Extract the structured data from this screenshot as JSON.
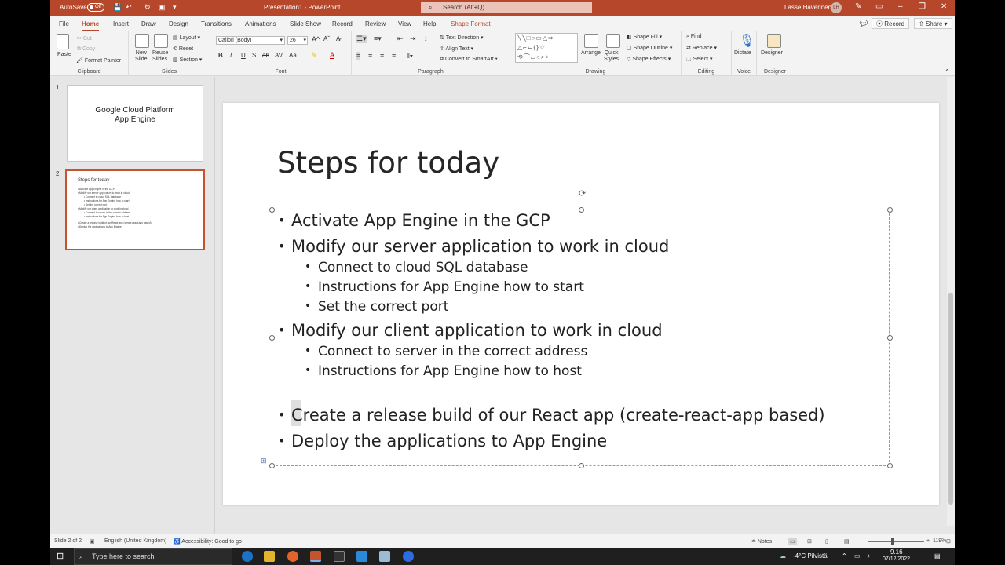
{
  "titlebar": {
    "autosave_label": "AutoSave",
    "autosave_state": "Off",
    "doc_title": "Presentation1 - PowerPoint",
    "search_placeholder": "Search (Alt+Q)",
    "user_name": "Lasse Haverinen",
    "user_initials": "LH"
  },
  "menu": {
    "tabs": [
      "File",
      "Home",
      "Insert",
      "Draw",
      "Design",
      "Transitions",
      "Animations",
      "Slide Show",
      "Record",
      "Review",
      "View",
      "Help",
      "Shape Format"
    ],
    "active": "Home",
    "record_button": "Record",
    "share_button": "Share"
  },
  "ribbon": {
    "clipboard": {
      "paste": "Paste",
      "cut": "Cut",
      "copy": "Copy",
      "format_painter": "Format Painter",
      "label": "Clipboard"
    },
    "slides": {
      "new_slide": "New\nSlide",
      "reuse_slides": "Reuse\nSlides",
      "layout": "Layout",
      "reset": "Reset",
      "section": "Section",
      "label": "Slides"
    },
    "font": {
      "family": "Calibri (Body)",
      "size": "26",
      "label": "Font",
      "buttons": [
        "B",
        "I",
        "U",
        "S",
        "ab",
        "AV",
        "Aa"
      ]
    },
    "paragraph": {
      "text_direction": "Text Direction",
      "align_text": "Align Text",
      "convert_smartart": "Convert to SmartArt",
      "label": "Paragraph"
    },
    "drawing": {
      "arrange": "Arrange",
      "quick_styles": "Quick\nStyles",
      "shape_fill": "Shape Fill",
      "shape_outline": "Shape Outline",
      "shape_effects": "Shape Effects",
      "label": "Drawing"
    },
    "editing": {
      "find": "Find",
      "replace": "Replace",
      "select": "Select",
      "label": "Editing"
    },
    "voice": {
      "dictate": "Dictate",
      "label": "Voice"
    },
    "designer": {
      "designer": "Designer",
      "label": "Designer"
    }
  },
  "thumbnails": [
    {
      "number": "1",
      "title": "Google Cloud Platform\nApp Engine"
    },
    {
      "number": "2",
      "title": "Steps for today",
      "lines": [
        {
          "level": 1,
          "text": "• Activate App Engine in the GCP"
        },
        {
          "level": 1,
          "text": "• Modify our server application to work in cloud"
        },
        {
          "level": 2,
          "text": "• Connect to cloud SQL database"
        },
        {
          "level": 2,
          "text": "• Instructions for App Engine how to start"
        },
        {
          "level": 2,
          "text": "• Set the correct port"
        },
        {
          "level": 1,
          "text": "• Modify our client application to work in cloud"
        },
        {
          "level": 2,
          "text": "• Connect to server in the correct address"
        },
        {
          "level": 2,
          "text": "• Instructions for App Engine how to host"
        },
        {
          "level": 1,
          "text": "• Create a release build of our React app (create-react-app based)"
        },
        {
          "level": 1,
          "text": "• Deploy the applications to App Engine"
        }
      ]
    }
  ],
  "slide": {
    "title": "Steps for today",
    "bullets": [
      {
        "level": 1,
        "text": "Activate App Engine in the GCP"
      },
      {
        "level": 1,
        "text": "Modify our server application to work in cloud"
      },
      {
        "level": 2,
        "text": "Connect to cloud SQL database"
      },
      {
        "level": 2,
        "text": "Instructions for App Engine how to start"
      },
      {
        "level": 2,
        "text": "Set the correct port"
      },
      {
        "level": 1,
        "text": "Modify our client application to work in cloud"
      },
      {
        "level": 2,
        "text": "Connect to server in the correct address"
      },
      {
        "level": 2,
        "text": "Instructions for App Engine how to host"
      },
      {
        "level": 1,
        "text": "Create a release build of our React app (create-react-app based)"
      },
      {
        "level": 1,
        "text": "Deploy the applications to App Engine"
      }
    ]
  },
  "statusbar": {
    "slide_count": "Slide 2 of 2",
    "language": "English (United Kingdom)",
    "accessibility": "Accessibility: Good to go",
    "notes": "Notes",
    "zoom": "119%"
  },
  "taskbar": {
    "search_placeholder": "Type here to search",
    "weather": "-4°C  Pilvistä",
    "time": "9.16",
    "date": "07/12/2022"
  },
  "colors": {
    "accent": "#b7472a",
    "selection": "#c4532e"
  }
}
